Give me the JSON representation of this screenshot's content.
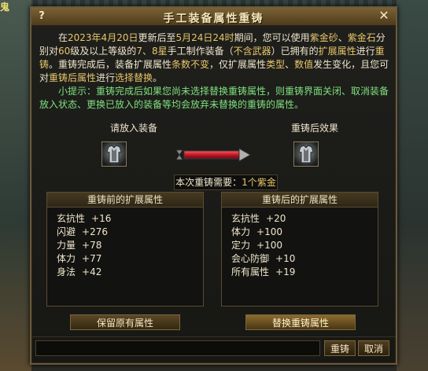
{
  "scene": {
    "corner_text": "鬼"
  },
  "window": {
    "title": "手工装备属性重铸",
    "help_label": "?",
    "close_label": "✕"
  },
  "description": {
    "para1": [
      {
        "t": "在",
        "c": "w"
      },
      {
        "t": "2023年4月20日",
        "c": "y"
      },
      {
        "t": "更新后至",
        "c": "w"
      },
      {
        "t": "5月24日24时",
        "c": "y"
      },
      {
        "t": "期间，您可以使用",
        "c": "w"
      },
      {
        "t": "紫金砂",
        "c": "y"
      },
      {
        "t": "、",
        "c": "w"
      },
      {
        "t": "紫金石",
        "c": "y"
      },
      {
        "t": "分别对",
        "c": "w"
      },
      {
        "t": "60",
        "c": "y"
      },
      {
        "t": "级及以上等级的",
        "c": "w"
      },
      {
        "t": "7、8星",
        "c": "y"
      },
      {
        "t": "手工制作装备（",
        "c": "w"
      },
      {
        "t": "不含武器",
        "c": "y"
      },
      {
        "t": "）已拥有的",
        "c": "w"
      },
      {
        "t": "扩展属性",
        "c": "y"
      },
      {
        "t": "进行",
        "c": "w"
      },
      {
        "t": "重铸",
        "c": "y"
      },
      {
        "t": "。重铸完成后，装备扩展属性",
        "c": "w"
      },
      {
        "t": "条数不变",
        "c": "y"
      },
      {
        "t": "，仅扩展属性",
        "c": "w"
      },
      {
        "t": "类型",
        "c": "y"
      },
      {
        "t": "、",
        "c": "w"
      },
      {
        "t": "数值",
        "c": "y"
      },
      {
        "t": "发生变化，且您可对",
        "c": "w"
      },
      {
        "t": "重铸后属性",
        "c": "y"
      },
      {
        "t": "进行",
        "c": "w"
      },
      {
        "t": "选择替换",
        "c": "y"
      },
      {
        "t": "。",
        "c": "w"
      }
    ],
    "para2": [
      {
        "t": "小提示：重铸完成后如果您尚未选择替换重铸属性，则重铸界面关闭、取消装备放入状态、更换已放入的装备等均会放弃未替换的重铸的属性。",
        "c": "g"
      }
    ]
  },
  "slots": {
    "left_label": "请放入装备",
    "right_label": "重铸后效果"
  },
  "cost": {
    "prefix": "本次重铸需要：",
    "amount": "1个",
    "item": "紫金石"
  },
  "before": {
    "header": "重铸前的扩展属性",
    "attrs": [
      {
        "name": "玄抗性",
        "value": "+16"
      },
      {
        "name": "闪避",
        "value": "+276"
      },
      {
        "name": "力量",
        "value": "+78"
      },
      {
        "name": "体力",
        "value": "+77"
      },
      {
        "name": "身法",
        "value": "+42"
      }
    ]
  },
  "after": {
    "header": "重铸后的扩展属性",
    "attrs": [
      {
        "name": "玄抗性",
        "value": "+20"
      },
      {
        "name": "体力",
        "value": "+100"
      },
      {
        "name": "定力",
        "value": "+100"
      },
      {
        "name": "会心防御",
        "value": "+10"
      },
      {
        "name": "所有属性",
        "value": "+19"
      }
    ]
  },
  "buttons": {
    "keep": "保留原有属性",
    "replace": "替换重铸属性",
    "recast": "重铸",
    "cancel": "取消"
  },
  "colors": {
    "highlight_yellow": "#e8c66a",
    "highlight_green": "#7fe07f",
    "frame_gold": "#6b5a3a",
    "arrow_red": "#c0182a"
  }
}
